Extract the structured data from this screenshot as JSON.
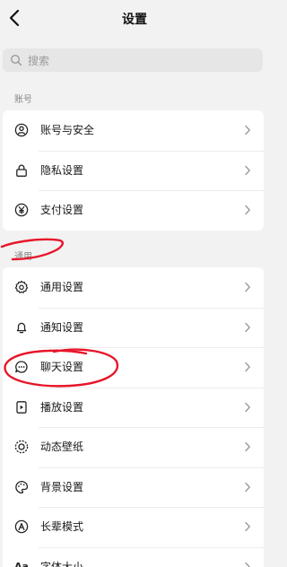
{
  "header": {
    "title": "设置"
  },
  "search": {
    "placeholder": "搜索"
  },
  "sections": {
    "account": {
      "label": "账号",
      "items": [
        {
          "label": "账号与安全",
          "icon": "user-circle-icon"
        },
        {
          "label": "隐私设置",
          "icon": "lock-icon"
        },
        {
          "label": "支付设置",
          "icon": "yen-icon"
        }
      ]
    },
    "general": {
      "label": "通用",
      "items": [
        {
          "label": "通用设置",
          "icon": "gear-icon"
        },
        {
          "label": "通知设置",
          "icon": "bell-icon"
        },
        {
          "label": "聊天设置",
          "icon": "chat-bubble-icon"
        },
        {
          "label": "播放设置",
          "icon": "play-icon"
        },
        {
          "label": "动态壁纸",
          "icon": "dynamic-wallpaper-icon"
        },
        {
          "label": "背景设置",
          "icon": "palette-icon"
        },
        {
          "label": "长辈模式",
          "icon": "elder-mode-icon"
        },
        {
          "label": "字体大小",
          "icon": "font-size-icon",
          "icon_text": "Aa"
        }
      ]
    }
  },
  "colors": {
    "annotation": "#e8152a"
  }
}
